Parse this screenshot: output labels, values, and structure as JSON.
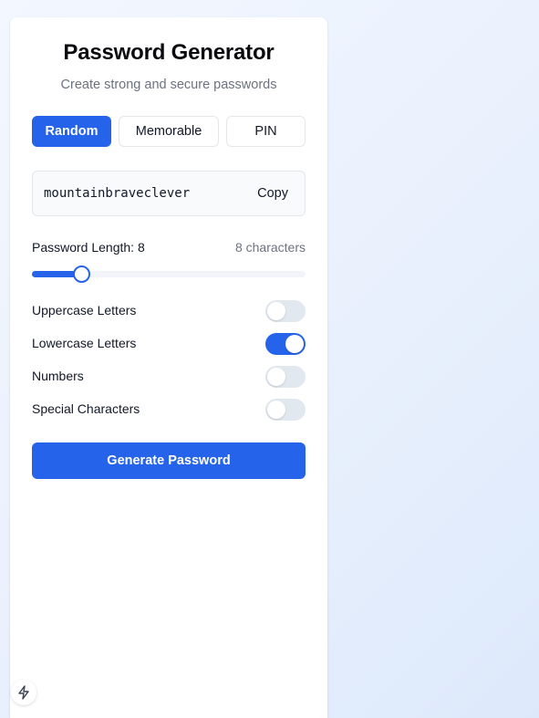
{
  "header": {
    "title": "Password Generator",
    "subtitle": "Create strong and secure passwords"
  },
  "tabs": [
    {
      "label": "Random",
      "active": true
    },
    {
      "label": "Memorable",
      "active": false
    },
    {
      "label": "PIN",
      "active": false
    }
  ],
  "output": {
    "password": "mountainbraveclever",
    "copy_label": "Copy"
  },
  "length": {
    "label": "Password Length: 8",
    "count_label": "8 characters",
    "value": 8,
    "fill_fraction": 0.18
  },
  "options": [
    {
      "label": "Uppercase Letters",
      "enabled": false
    },
    {
      "label": "Lowercase Letters",
      "enabled": true
    },
    {
      "label": "Numbers",
      "enabled": false
    },
    {
      "label": "Special Characters",
      "enabled": false
    }
  ],
  "generate_label": "Generate Password",
  "colors": {
    "accent": "#2563eb",
    "toggle_off": "#e2e8f0",
    "muted_text": "#6b7280"
  },
  "icons": {
    "bottom_badge": "lightning-bolt-icon"
  }
}
